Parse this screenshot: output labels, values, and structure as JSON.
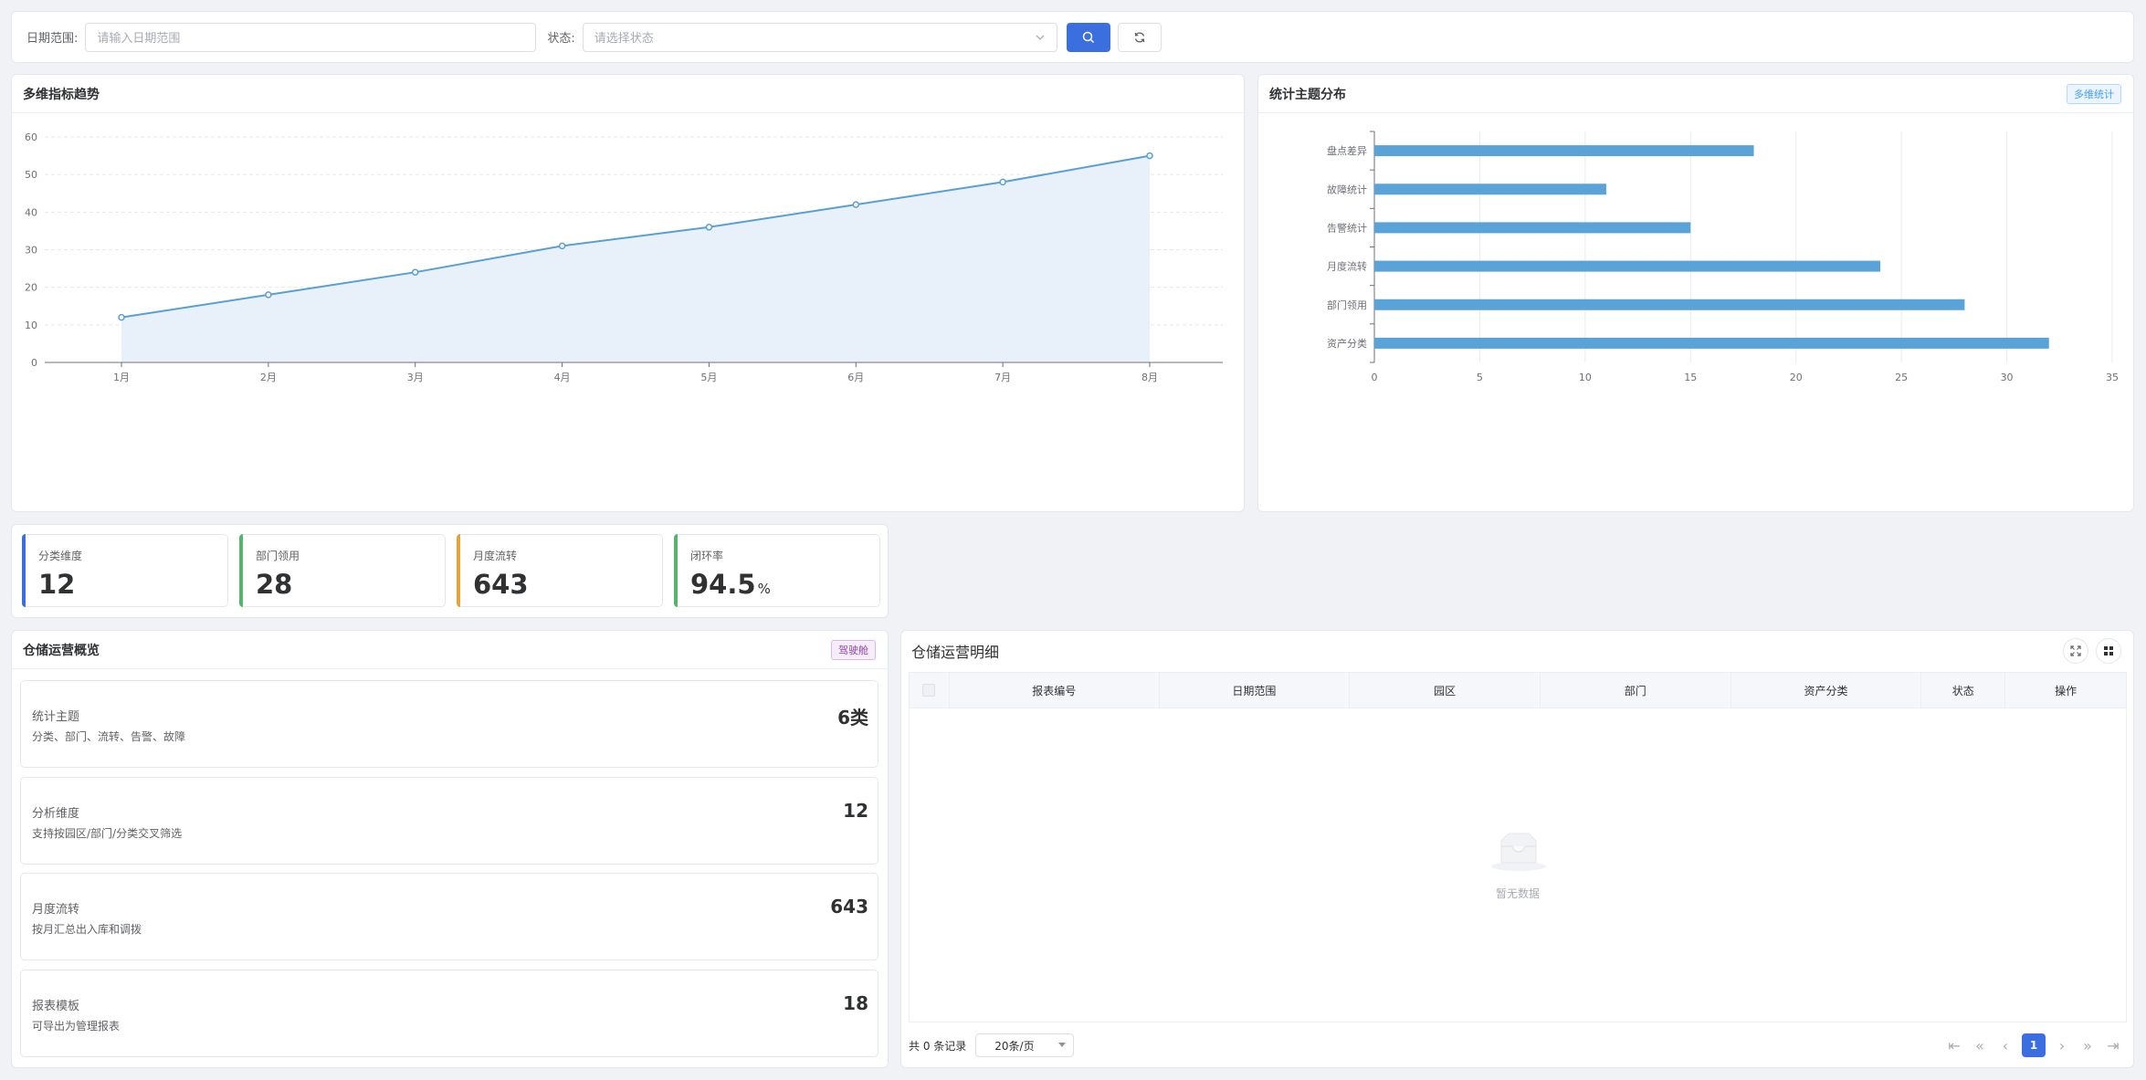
{
  "filter": {
    "date_label": "日期范围:",
    "date_placeholder": "请输入日期范围",
    "status_label": "状态:",
    "status_placeholder": "请选择状态"
  },
  "trend": {
    "title": "多维指标趋势"
  },
  "distribution": {
    "title": "统计主题分布",
    "tag": "多维统计"
  },
  "stats": [
    {
      "label": "分类维度",
      "value": "12",
      "unit": "",
      "color": "#3b6fe0"
    },
    {
      "label": "部门领用",
      "value": "28",
      "unit": "",
      "color": "#53b66b"
    },
    {
      "label": "月度流转",
      "value": "643",
      "unit": "",
      "color": "#e6a23c"
    },
    {
      "label": "闭环率",
      "value": "94.5",
      "unit": "%",
      "color": "#53b66b"
    }
  ],
  "overview": {
    "title": "仓储运营概览",
    "tag": "驾驶舱",
    "items": [
      {
        "title": "统计主题",
        "desc": "分类、部门、流转、告警、故障",
        "value": "6类"
      },
      {
        "title": "分析维度",
        "desc": "支持按园区/部门/分类交叉筛选",
        "value": "12"
      },
      {
        "title": "月度流转",
        "desc": "按月汇总出入库和调拨",
        "value": "643"
      },
      {
        "title": "报表模板",
        "desc": "可导出为管理报表",
        "value": "18"
      }
    ]
  },
  "detail": {
    "title": "仓储运营明细",
    "columns": [
      "报表编号",
      "日期范围",
      "园区",
      "部门",
      "资产分类",
      "状态",
      "操作"
    ],
    "empty_text": "暂无数据",
    "total_text": "共 0 条记录",
    "page_size": "20条/页",
    "current_page": "1"
  },
  "colors": {
    "primary": "#3b6fe0",
    "line": "#5a9fd4",
    "area": "#e6f0fa",
    "bar": "#5aa3d8"
  },
  "chart_data": [
    {
      "type": "area",
      "title": "多维指标趋势",
      "categories": [
        "1月",
        "2月",
        "3月",
        "4月",
        "5月",
        "6月",
        "7月",
        "8月"
      ],
      "values": [
        12,
        18,
        24,
        31,
        36,
        42,
        48,
        55
      ],
      "ylim": [
        0,
        60
      ],
      "yticks": [
        0,
        10,
        20,
        30,
        40,
        50,
        60
      ],
      "grid": "horizontal-dashed",
      "legend": "none"
    },
    {
      "type": "bar",
      "orientation": "horizontal",
      "title": "统计主题分布",
      "categories": [
        "资产分类",
        "部门领用",
        "月度流转",
        "告警统计",
        "故障统计",
        "盘点差异"
      ],
      "values": [
        32,
        28,
        24,
        15,
        11,
        18
      ],
      "xlim": [
        0,
        35
      ],
      "xticks": [
        0,
        5,
        10,
        15,
        20,
        25,
        30,
        35
      ],
      "grid": "vertical",
      "legend": "none"
    }
  ]
}
